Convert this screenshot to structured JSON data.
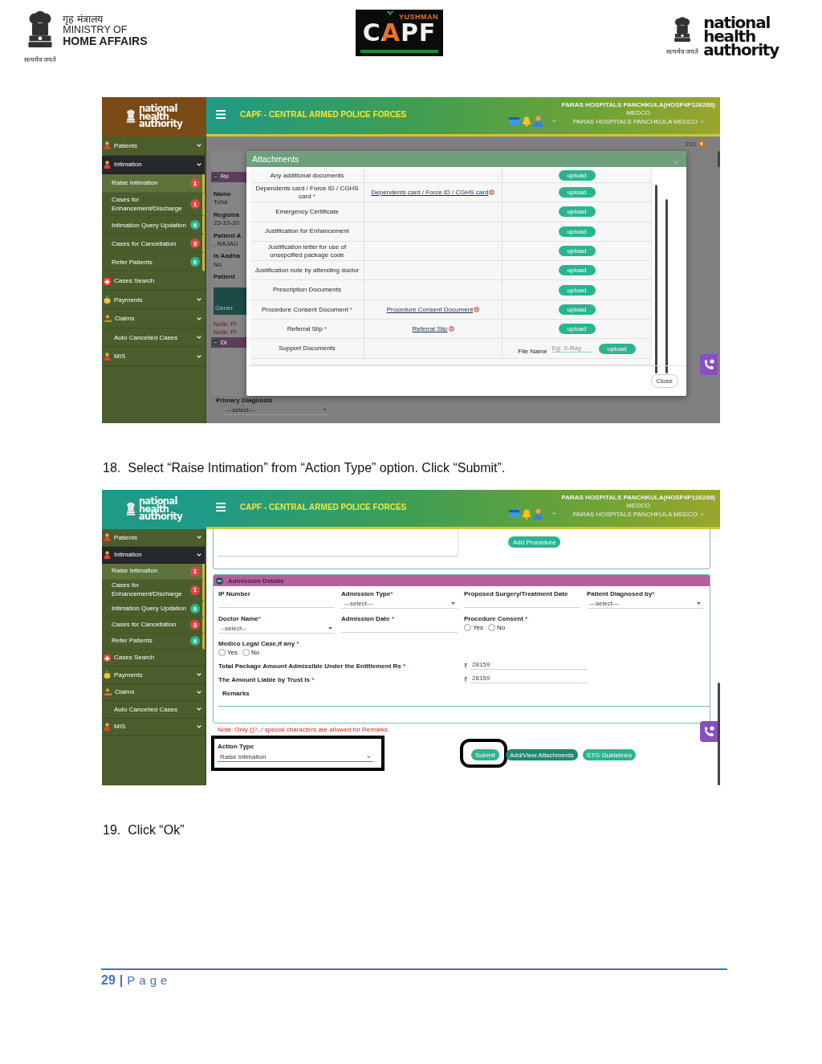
{
  "header": {
    "ministry_logo": {
      "lines": [
        "गृह मंत्रालय",
        "MINISTRY OF",
        "HOME AFFAIRS"
      ],
      "motto": "सत्यमेव जयते"
    },
    "capf_logo": {
      "top": "YUSHMAN",
      "main": "CAPF"
    },
    "nha_logo": {
      "lines": [
        "national",
        "health",
        "authority"
      ],
      "motto": "सत्यमेव जयते"
    }
  },
  "screenshot_1": {
    "app": {
      "logo": [
        "national",
        "health",
        "authority"
      ],
      "title": "CAPF - CENTRAL ARMED POLICE FORCES",
      "user": [
        "PARAS HOSPITALS PANCHKULA(HOSP4P126288)",
        "MEDCO",
        "PARAS HOSPITALS PANCHKULA MEDCO"
      ],
      "sidebar": [
        {
          "label": "Patients",
          "kind": "group",
          "expanded": false
        },
        {
          "label": "Intimation",
          "kind": "group",
          "expanded": true,
          "children": [
            {
              "label": "Raise Intimation",
              "badge": "1",
              "color": "#e04848",
              "selected": true
            },
            {
              "label": "Cases for Enhancement/Discharge",
              "badge": "1",
              "color": "#e04848",
              "selected": false
            },
            {
              "label": "Intimation Query Updation",
              "badge": "0",
              "color": "#2bb58f",
              "selected": false
            },
            {
              "label": "Cases for Cancellation",
              "badge": "3",
              "color": "#e04848",
              "selected": false
            },
            {
              "label": "Refer Patients",
              "badge": "0",
              "color": "#2bb58f",
              "selected": false
            }
          ]
        },
        {
          "label": "Cases Search",
          "kind": "link"
        },
        {
          "label": "Payments",
          "kind": "group",
          "expanded": false
        },
        {
          "label": "Claims",
          "kind": "group",
          "expanded": false
        },
        {
          "label": "Auto Cancelled Cases",
          "kind": "group",
          "expanded": false
        },
        {
          "label": "MIS",
          "kind": "group",
          "expanded": false
        }
      ]
    },
    "background": {
      "counter": "230",
      "items": [
        {
          "kind": "header",
          "text": "Re"
        },
        {
          "kind": "label",
          "text": "Name"
        },
        {
          "kind": "value",
          "text": "Toha"
        },
        {
          "kind": "label",
          "text": "Registra"
        },
        {
          "kind": "value",
          "text": "23-10-20"
        },
        {
          "kind": "label",
          "text": "Patient A"
        },
        {
          "kind": "value",
          "text": ", RAJAU"
        },
        {
          "kind": "label",
          "text": "Is Aadha"
        },
        {
          "kind": "value",
          "text": "No"
        },
        {
          "kind": "label",
          "text": "Patient"
        },
        {
          "kind": "tile",
          "text": "Gener"
        },
        {
          "kind": "note",
          "text": "Note: Pl"
        },
        {
          "kind": "note",
          "text": "Note: Pl"
        },
        {
          "kind": "header",
          "text": "Di"
        }
      ],
      "bottom_label": "Primary Diagnosis",
      "bottom_select": "---select---"
    },
    "modal": {
      "title": "Attachments",
      "close_icon": "×",
      "close_button": "Close",
      "rows": [
        {
          "kind": "doc",
          "name": "Any additional documents",
          "button": "upload"
        },
        {
          "kind": "doc",
          "name": "Dependents card / Force ID / CGHS card",
          "star": "*",
          "link": "Dependents card / Force ID / CGHS card",
          "button": "upload"
        },
        {
          "kind": "doc",
          "name": "Emergency Certificate",
          "button": "upload"
        },
        {
          "kind": "doc",
          "name": "Justification for Enhancement",
          "button": "upload"
        },
        {
          "kind": "doc",
          "name": "Justification letter for use of unsepcified package code",
          "button": "upload"
        },
        {
          "kind": "doc",
          "name": "Justification note by attending doctor",
          "button": "upload"
        },
        {
          "kind": "doc",
          "name": "Prescription Documents",
          "button": "upload"
        },
        {
          "kind": "doc",
          "name": "Procedure Consent Document",
          "star": "*",
          "link": "Procedure Consent Document",
          "button": "upload"
        },
        {
          "kind": "doc",
          "name": "Referral Slip",
          "star": "*",
          "link": "Referral Slip",
          "button": "upload"
        },
        {
          "kind": "file",
          "name": "Support Documents",
          "file_label": "File Name",
          "placeholder": "Eg: X-Ray",
          "button": "upload"
        }
      ]
    }
  },
  "step_18": {
    "number": "18.",
    "text": "Select “Raise Intimation” from “Action Type” option. Click “Submit”."
  },
  "screenshot_2": {
    "app": {
      "logo": [
        "national",
        "health",
        "authority"
      ],
      "title": "CAPF - CENTRAL ARMED POLICE FORCES",
      "user": [
        "PARAS HOSPITALS PANCHKULA(HOSP4P126288)",
        "MEDCO",
        "PARAS HOSPITALS PANCHKULA MEDCO"
      ],
      "sidebar": [
        {
          "label": "Patients",
          "kind": "group",
          "expanded": false
        },
        {
          "label": "Intimation",
          "kind": "group",
          "expanded": true,
          "children": [
            {
              "label": "Raise Intimation",
              "badge": "1",
              "color": "#e04848",
              "selected": true
            },
            {
              "label": "Cases for Enhancement/Discharge",
              "badge": "1",
              "color": "#e04848",
              "selected": false
            },
            {
              "label": "Intimation Query Updation",
              "badge": "0",
              "color": "#2bb58f",
              "selected": false
            },
            {
              "label": "Cases for Cancellation",
              "badge": "3",
              "color": "#e04848",
              "selected": false
            },
            {
              "label": "Refer Patients",
              "badge": "0",
              "color": "#2bb58f",
              "selected": false
            }
          ]
        },
        {
          "label": "Cases Search",
          "kind": "link"
        },
        {
          "label": "Payments",
          "kind": "group",
          "expanded": false
        },
        {
          "label": "Claims",
          "kind": "group",
          "expanded": false
        },
        {
          "label": "Auto Cancelled Cases",
          "kind": "group",
          "expanded": false
        },
        {
          "label": "MIS",
          "kind": "group",
          "expanded": false
        }
      ]
    },
    "form": {
      "add_button": "Add Procedure",
      "section_title": "Admission Details",
      "grid": [
        {
          "kind": "input",
          "label": "IP Number"
        },
        {
          "kind": "select",
          "label": "Admission Type",
          "star": "*",
          "value": "---select---"
        },
        {
          "kind": "input",
          "label": "Proposed Surgery/Treatment Date"
        },
        {
          "kind": "select",
          "label": "Patient Diagnosed by",
          "star": "*",
          "value": "---select---"
        },
        {
          "kind": "select",
          "label": "Doctor Name",
          "star": "*",
          "value": "--select--"
        },
        {
          "kind": "input",
          "label": "Admission Date",
          "star": " *"
        },
        {
          "kind": "radio",
          "label": "Procedure Consent",
          "star": " *",
          "options": [
            {
              "label": "Yes",
              "selected": false
            },
            {
              "label": "No",
              "selected": false
            }
          ]
        }
      ],
      "rows": [
        {
          "kind": "radio",
          "label": "Medico Legal Case,If any",
          "star": " *",
          "options": [
            {
              "label": "Yes",
              "selected": false
            },
            {
              "label": "No",
              "selected": false
            }
          ]
        },
        {
          "kind": "amount",
          "label": "Total Package Amount Admissible Under the Entitlement Rs",
          "star": " *",
          "currency": "₹",
          "value": "28159"
        },
        {
          "kind": "amount",
          "label": "The Amount Liable by Trust Is",
          "star": " *",
          "currency": "₹",
          "value": "28159"
        },
        {
          "kind": "textarea",
          "label": "Remarks"
        }
      ],
      "note": "Note: Only ()?,./ special characters are allowed for Remarks",
      "action_type": {
        "label": "Action Type",
        "value": "Raise Intimation",
        "highlighted": true
      },
      "buttons": [
        {
          "label": "Submit",
          "kind": "primary",
          "highlighted": true
        },
        {
          "label": "Add/View Attachments",
          "kind": "dark",
          "highlighted": false
        },
        {
          "label": "STG Guidelines",
          "kind": "primary",
          "highlighted": false
        }
      ]
    }
  },
  "step_19": {
    "number": "19.",
    "text": "Click “Ok”"
  },
  "footer": {
    "page_number": "29",
    "separator": "|",
    "label": "Page"
  }
}
